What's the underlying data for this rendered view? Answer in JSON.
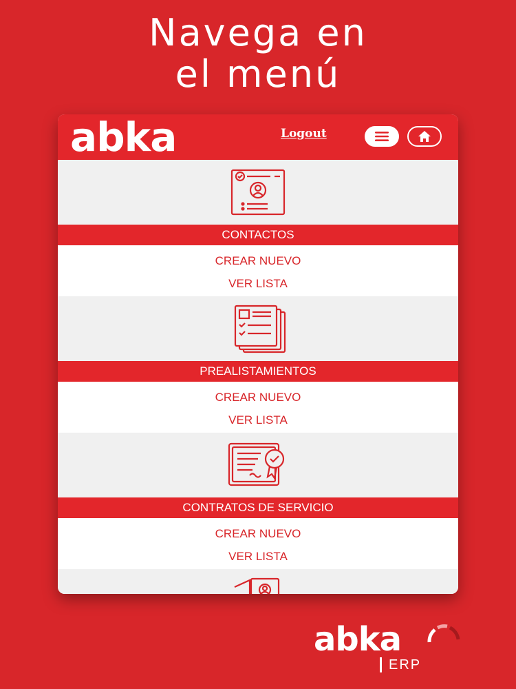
{
  "promo": {
    "title_line1": "Navega en",
    "title_line2": "el menú"
  },
  "header": {
    "logo": "abka",
    "logout_label": "Logout",
    "menu_icon": "hamburger-menu-icon",
    "home_icon": "home-icon"
  },
  "sections": [
    {
      "icon": "contact-card-icon",
      "title": "CONTACTOS",
      "create_label": "CREAR NUEVO",
      "list_label": "VER LISTA"
    },
    {
      "icon": "documents-stack-icon",
      "title": "PREALISTAMIENTOS",
      "create_label": "CREAR NUEVO",
      "list_label": "VER LISTA"
    },
    {
      "icon": "certificate-icon",
      "title": "CONTRATOS DE SERVICIO",
      "create_label": "CREAR NUEVO",
      "list_label": "VER LISTA"
    }
  ],
  "partial_section": {
    "icon": "id-badge-icon"
  },
  "brand": {
    "logo": "abka",
    "sub": "ERP"
  },
  "colors": {
    "background": "#d8262a",
    "header": "#e3262b",
    "accent": "#d8262a",
    "band": "#f0f0f0"
  }
}
